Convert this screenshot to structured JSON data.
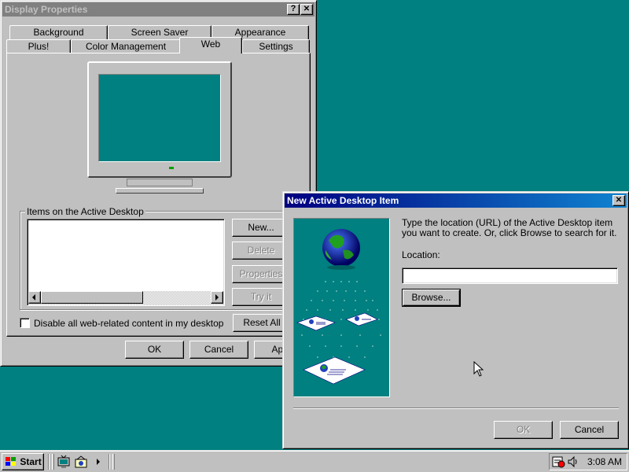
{
  "display_properties": {
    "title": "Display Properties",
    "help_btn": "?",
    "close_btn": "✕",
    "tabs_back": [
      "Background",
      "Screen Saver",
      "Appearance"
    ],
    "tabs_front": [
      "Plus!",
      "Color Management",
      "Web",
      "Settings"
    ],
    "selected_tab": "Web",
    "group_label": "Items on the Active Desktop",
    "new_btn": "New...",
    "delete_btn": "Delete",
    "properties_btn": "Properties",
    "tryit_btn": "Try it",
    "reset_btn": "Reset All",
    "checkbox_label": "Disable all web-related content in my desktop",
    "ok_btn": "OK",
    "cancel_btn": "Cancel",
    "apply_btn": "Apply"
  },
  "dialog": {
    "title": "New Active Desktop Item",
    "close_btn": "✕",
    "instructions": "Type the location (URL) of the Active Desktop item you want to create. Or, click Browse to search for it.",
    "location_label": "Location:",
    "location_value": "",
    "browse_btn": "Browse...",
    "ok_btn": "OK",
    "cancel_btn": "Cancel"
  },
  "taskbar": {
    "start_label": "Start",
    "clock": "3:08 AM"
  },
  "colors": {
    "desktop": "#008080",
    "face": "#c0c0c0",
    "title_active": "#000080",
    "title_inactive": "#808080"
  }
}
